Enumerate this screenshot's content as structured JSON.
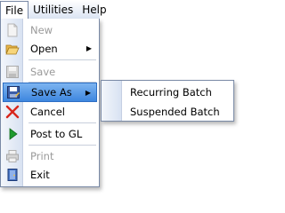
{
  "menubar": {
    "items": [
      {
        "label": "File"
      },
      {
        "label": "Utilities"
      },
      {
        "label": "Help"
      }
    ]
  },
  "file_menu": {
    "items": [
      {
        "label": "New",
        "icon": "new-document-icon",
        "disabled": true
      },
      {
        "label": "Open",
        "icon": "open-folder-icon",
        "submenu": true
      },
      {
        "label": "Save",
        "icon": "save-icon",
        "disabled": true
      },
      {
        "label": "Save As",
        "icon": "save-as-icon",
        "submenu": true,
        "highlighted": true
      },
      {
        "label": "Cancel",
        "icon": "cancel-x-icon"
      },
      {
        "label": "Post to GL",
        "icon": "play-arrow-icon"
      },
      {
        "label": "Print",
        "icon": "printer-icon",
        "disabled": true
      },
      {
        "label": "Exit",
        "icon": "exit-door-icon"
      }
    ]
  },
  "save_as_submenu": {
    "items": [
      {
        "label": "Recurring Batch"
      },
      {
        "label": "Suspended Batch"
      }
    ]
  },
  "colors": {
    "highlight": "#3d86df",
    "disabled_text": "#9a9a9a",
    "border": "#7a8aa6"
  }
}
